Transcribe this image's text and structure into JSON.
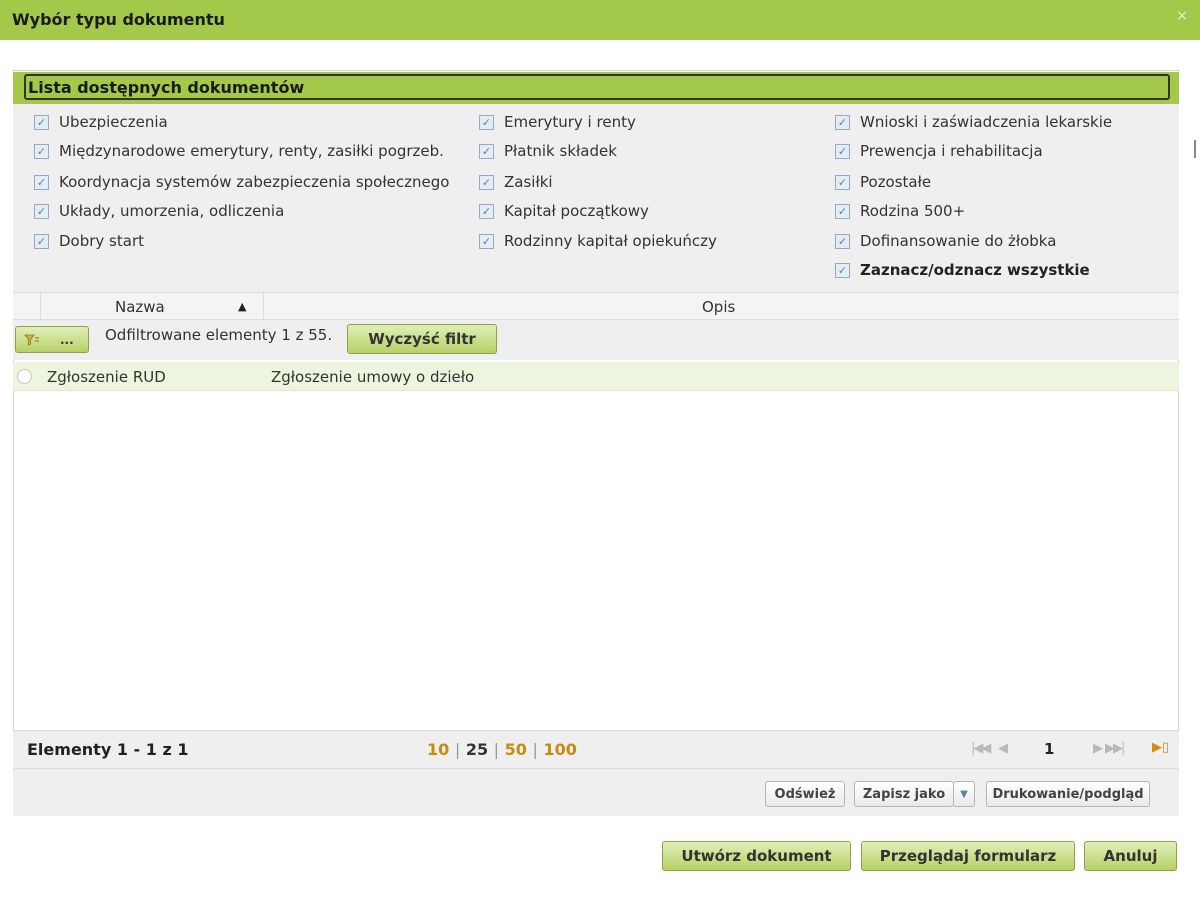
{
  "dialog": {
    "title": "Wybór typu dokumentu",
    "close_symbol": "×"
  },
  "panel": {
    "title": "Lista dostępnych dokumentów"
  },
  "filters": {
    "col1": [
      "Ubezpieczenia",
      "Międzynarodowe emerytury, renty, zasiłki pogrzeb.",
      "Koordynacja systemów zabezpieczenia społecznego",
      "Układy, umorzenia, odliczenia",
      "Dobry start"
    ],
    "col2": [
      "Emerytury i renty",
      "Płatnik składek",
      "Zasiłki",
      "Kapitał początkowy",
      "Rodzinny kapitał opiekuńczy"
    ],
    "col3": [
      "Wnioski i zaświadczenia lekarskie",
      "Prewencja i rehabilitacja",
      "Pozostałe",
      "Rodzina 500+",
      "Dofinansowanie do żłobka"
    ],
    "select_all": "Zaznacz/odznacz wszystkie",
    "check_mark": "✓"
  },
  "grid": {
    "columns": {
      "name": "Nazwa",
      "desc": "Opis"
    },
    "sort_arrow": "▲",
    "filter_button_label": "...",
    "filter_status": "Odfiltrowane elementy 1 z 55.",
    "clear_filter": "Wyczyść filtr",
    "rows": [
      {
        "name": "Zgłoszenie RUD",
        "desc": "Zgłoszenie umowy o dzieło"
      }
    ]
  },
  "pager": {
    "summary": "Elementy 1 - 1 z 1",
    "sizes": [
      "10",
      "25",
      "50",
      "100"
    ],
    "separator": "|",
    "first_symbol": "|◀◀",
    "prev_symbol": "◀",
    "page": "1",
    "next_symbol": "▶",
    "last_symbol": "▶▶|",
    "export_symbol": "▶▯"
  },
  "toolbar": {
    "refresh": "Odśwież",
    "save_as": "Zapisz jako",
    "save_as_arrow": "▼",
    "print": "Drukowanie/podgląd"
  },
  "actions": {
    "create": "Utwórz dokument",
    "browse": "Przeglądaj formularz",
    "cancel": "Anuluj"
  },
  "colors": {
    "accent": "#a4c84a",
    "panel_bg": "#efefef",
    "row_highlight": "#eef5df",
    "page_size_link": "#c88a12"
  }
}
